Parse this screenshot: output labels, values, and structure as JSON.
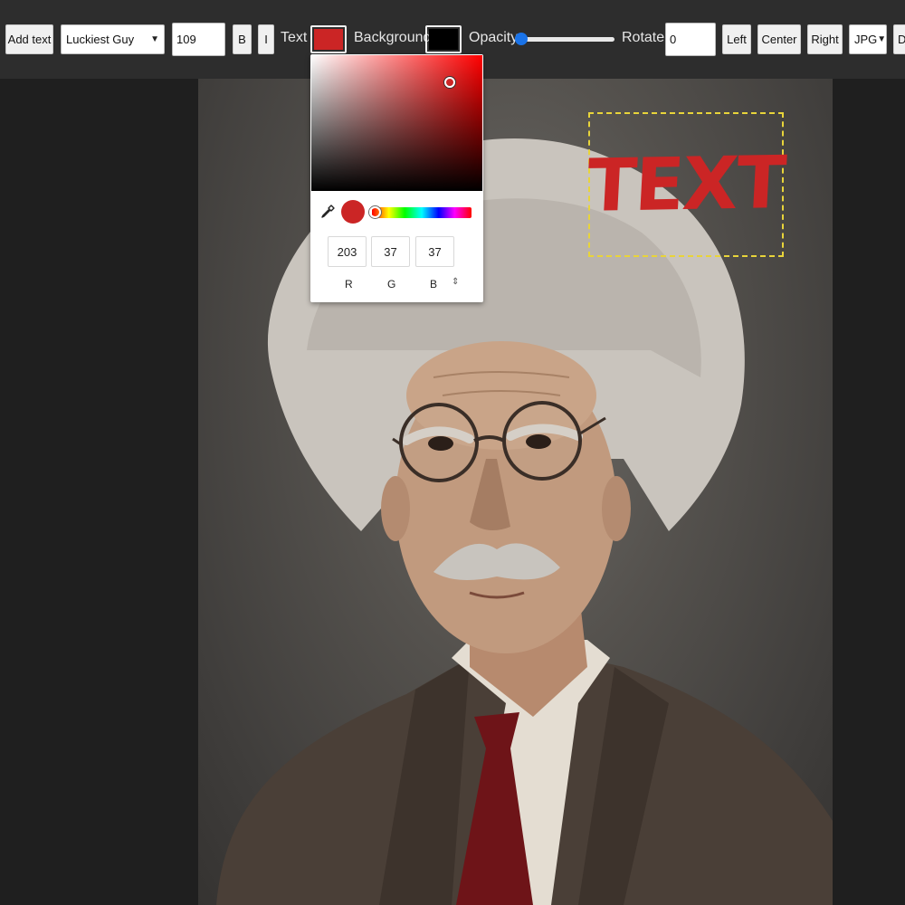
{
  "toolbar": {
    "add_text_label": "Add text",
    "font_family_value": "Luckiest Guy",
    "font_size_value": "109",
    "bold_label": "B",
    "italic_label": "I",
    "text_color_label": "Text",
    "text_color": "#cb2525",
    "background_label": "Background",
    "background_color": "#000000",
    "opacity_label": "Opacity",
    "opacity_value": 0,
    "rotate_label": "Rotate",
    "rotate_value": "0",
    "align_left_label": "Left",
    "align_center_label": "Center",
    "align_right_label": "Right",
    "format_value": "JPG",
    "download_label": "D"
  },
  "canvas": {
    "overlay_text": "Text",
    "overlay_color": "#cb2525",
    "selection_color": "#e8d43a"
  },
  "color_picker": {
    "r_value": "203",
    "g_value": "37",
    "b_value": "37",
    "r_label": "R",
    "g_label": "G",
    "b_label": "B",
    "mode_toggle": "⇕",
    "preview_color": "#cb2525",
    "hue_color": "#ff0000",
    "eyedropper_icon": "eyedropper-icon"
  }
}
